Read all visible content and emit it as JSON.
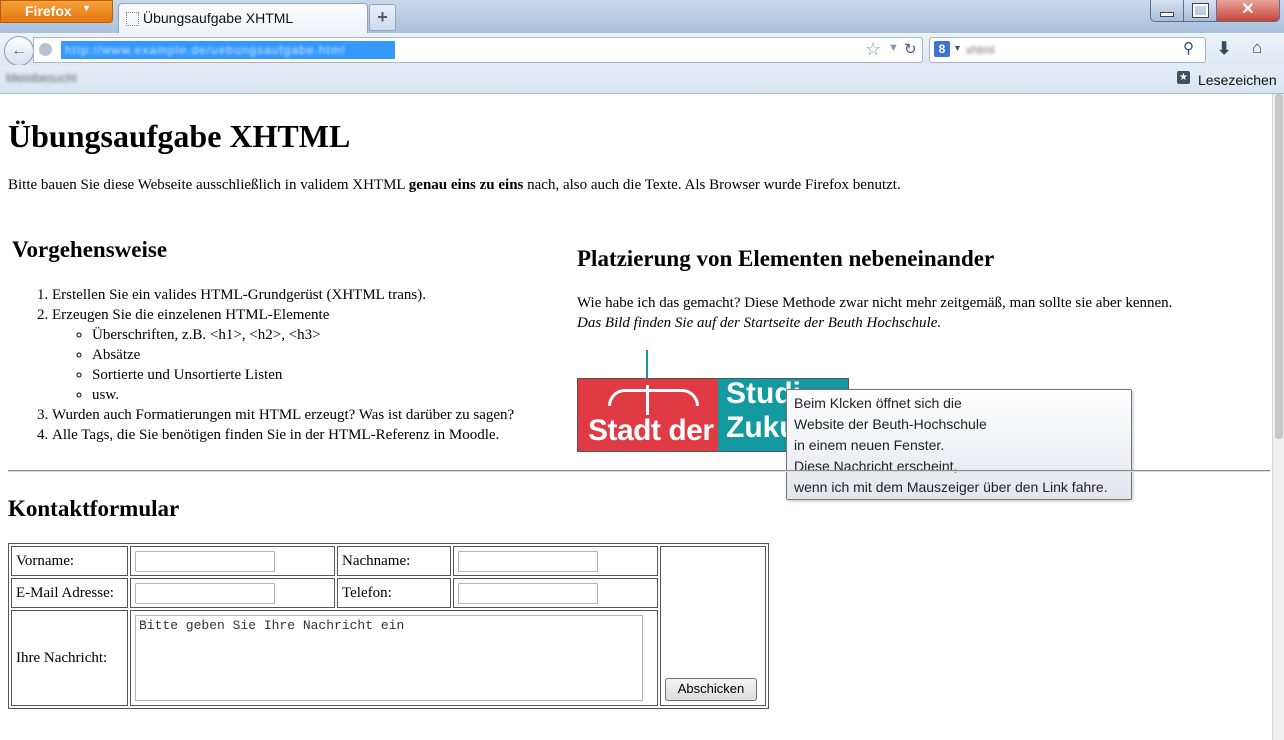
{
  "browser": {
    "menu_button": "Firefox",
    "tab_title": "Übungsaufgabe XHTML",
    "new_tab": "+",
    "url": "http://www.example.de/uebungsaufgabe.html",
    "search_value": "xhtml",
    "bookmarks_blur": "Meistbesucht",
    "bookmarks_label": "Lesezeichen"
  },
  "page": {
    "title": "Übungsaufgabe XHTML",
    "intro_before": "Bitte bauen Sie diese Webseite ausschließlich in validem XHTML ",
    "intro_bold": "genau eins zu eins",
    "intro_after": " nach, also auch die Texte. Als Browser wurde Firefox benutzt.",
    "vorgehen_heading": "Vorgehensweise",
    "steps": [
      "Erstellen Sie ein valides HTML-Grundgerüst (XHTML trans).",
      "Erzeugen Sie die einzelenen HTML-Elemente",
      "Wurden auch Formatierungen mit HTML erzeugt? Was ist darüber zu sagen?",
      "Alle Tags, die Sie benötigen finden Sie in der HTML-Referenz in Moodle."
    ],
    "substeps": [
      "Überschriften, z.B. <h1>, <h2>, <h3>",
      "Absätze",
      "Sortierte und Unsortierte Listen",
      "usw."
    ],
    "platz_heading": "Platzierung von Elementen nebeneinander",
    "platz_p1": "Wie habe ich das gemacht? Diese Methode zwar nicht mehr zeitgemäß, man sollte sie aber kennen.",
    "platz_p2": "Das Bild finden Sie auf der Startseite der Beuth Hochschule.",
    "banner_left": "Stadt der",
    "banner_right": "Studi Zuku",
    "tooltip_lines": [
      "Beim Klcken öffnet sich die",
      "Website der Beuth-Hochschule",
      "in einem neuen Fenster.",
      "Diese Nachricht erscheint,",
      "wenn ich mit dem Mauszeiger über den Link fahre."
    ],
    "kontakt_heading": "Kontaktformular"
  },
  "form": {
    "vorname_label": "Vorname:",
    "nachname_label": "Nachname:",
    "email_label": "E-Mail Adresse:",
    "telefon_label": "Telefon:",
    "nachricht_label": "Ihre Nachricht:",
    "nachricht_value": "Bitte geben Sie Ihre Nachricht ein",
    "submit_label": "Abschicken"
  },
  "colors": {
    "banner_red": "#e03b45",
    "banner_teal": "#129aa0",
    "firefox_orange": "#e3740d",
    "url_selection": "#3399ff"
  }
}
